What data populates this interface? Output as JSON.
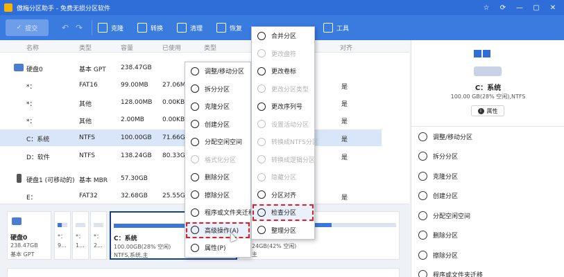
{
  "app": {
    "title": "傲梅分区助手 - 免费无损分区软件",
    "window_buttons": [
      "☆",
      "⟳",
      "—",
      "▢",
      "✕"
    ]
  },
  "toolbar": {
    "commit_label": "提交",
    "undo": "↶",
    "redo": "↷",
    "items": [
      {
        "label": "克隆",
        "icon": "clone-icon"
      },
      {
        "label": "转换",
        "icon": "convert-icon"
      },
      {
        "label": "清理",
        "icon": "clean-icon"
      },
      {
        "label": "恢复",
        "icon": "restore-icon"
      },
      {
        "label": "工具",
        "icon": "tools-icon"
      }
    ]
  },
  "table": {
    "headers": [
      "名称",
      "类型",
      "容量",
      "已使用",
      "类型",
      "对齐"
    ],
    "rows": [
      {
        "name": "硬盘0",
        "type": "基本 GPT",
        "capacity": "238.47GB",
        "used": "",
        "fs": "",
        "align": ""
      },
      {
        "name": "*：",
        "type": "FAT16",
        "capacity": "99.00MB",
        "used": "27.06MB",
        "fs": "",
        "align": "是"
      },
      {
        "name": "*：",
        "type": "其他",
        "capacity": "128.00MB",
        "used": "0.00KB",
        "fs": "",
        "align": "是"
      },
      {
        "name": "*：",
        "type": "其他",
        "capacity": "2.00MB",
        "used": "0.00KB",
        "fs": "",
        "align": "是"
      },
      {
        "name": "C：系统",
        "type": "NTFS",
        "capacity": "100.00GB",
        "used": "71.66GB",
        "fs": "",
        "align": "是"
      },
      {
        "name": "D：软件",
        "type": "NTFS",
        "capacity": "138.24GB",
        "used": "80.33GB",
        "fs": "",
        "align": "是"
      },
      {
        "name": "硬盘1 (可移动的)",
        "type": "基本 MBR",
        "capacity": "57.30GB",
        "used": "",
        "fs": "",
        "align": ""
      },
      {
        "name": "E：",
        "type": "FAT32",
        "capacity": "32.68GB",
        "used": "25.55GB",
        "fs": "",
        "align": "是"
      }
    ]
  },
  "diskmap": {
    "disk_name": "硬盘0",
    "disk_size": "238.47GB",
    "disk_type": "基本 GPT",
    "small": [
      {
        "l1": "*：",
        "l2": "9..."
      },
      {
        "l1": "*：",
        "l2": "1..."
      },
      {
        "l1": "*：",
        "l2": "2..."
      }
    ],
    "c": {
      "l1": "C：系统",
      "l2": "100.00GB(28% 空闲)",
      "l3": "NTFS,系统,主",
      "used": 0.72
    },
    "d": {
      "l2": "24GB(42% 空闲)",
      "l3": "主",
      "used": 0.58
    }
  },
  "rpanel": {
    "title": "C：系统",
    "subtitle": "100.00 GB(28% 空闲),NTFS",
    "props_label": "属性",
    "items": [
      {
        "label": "调整/移动分区",
        "icon": "resize-icon"
      },
      {
        "label": "拆分分区",
        "icon": "split-icon"
      },
      {
        "label": "克隆分区",
        "icon": "clone-partition-icon"
      },
      {
        "label": "创建分区",
        "icon": "create-icon"
      },
      {
        "label": "分配空闲空间",
        "icon": "allocate-icon"
      },
      {
        "label": "删除分区",
        "icon": "delete-icon"
      },
      {
        "label": "擦除分区",
        "icon": "wipe-icon"
      },
      {
        "label": "程序或文件夹迁移",
        "icon": "migrate-icon"
      }
    ]
  },
  "menu1": [
    {
      "label": "调整/移动分区",
      "icon": "resize-icon",
      "state": "normal"
    },
    {
      "label": "拆分分区",
      "icon": "split-icon",
      "state": "normal"
    },
    {
      "label": "克隆分区",
      "icon": "clone-partition-icon",
      "state": "normal"
    },
    {
      "label": "创建分区",
      "icon": "create-icon",
      "state": "normal"
    },
    {
      "label": "分配空闲空间",
      "icon": "allocate-icon",
      "state": "normal"
    },
    {
      "label": "格式化分区",
      "icon": "format-icon",
      "state": "disabled"
    },
    {
      "label": "删除分区",
      "icon": "delete-icon",
      "state": "normal"
    },
    {
      "label": "擦除分区",
      "icon": "wipe-icon",
      "state": "normal"
    },
    {
      "label": "程序或文件夹迁移",
      "icon": "migrate-icon",
      "state": "normal"
    },
    {
      "label": "高级操作(A)",
      "icon": "more-icon",
      "state": "highlight"
    },
    {
      "label": "属性(P)",
      "icon": "info-icon",
      "state": "normal"
    }
  ],
  "menu2": [
    {
      "label": "合并分区",
      "icon": "merge-icon",
      "state": "normal"
    },
    {
      "label": "更改盘符",
      "icon": "drive-letter-icon",
      "state": "disabled"
    },
    {
      "label": "更改卷标",
      "icon": "label-icon",
      "state": "normal"
    },
    {
      "label": "更改分区类型",
      "icon": "id-icon",
      "state": "disabled"
    },
    {
      "label": "更改序列号",
      "icon": "serial-icon",
      "state": "normal"
    },
    {
      "label": "设置活动分区",
      "icon": "active-icon",
      "state": "disabled"
    },
    {
      "label": "转换成NTFS分区",
      "icon": "convert-ntfs-icon",
      "state": "disabled"
    },
    {
      "label": "转换成逻辑分区",
      "icon": "convert-logical-icon",
      "state": "disabled"
    },
    {
      "label": "隐藏分区",
      "icon": "hide-icon",
      "state": "disabled"
    },
    {
      "label": "分区对齐",
      "icon": "align-icon",
      "state": "normal"
    },
    {
      "label": "检查分区",
      "icon": "check-icon",
      "state": "highlight"
    },
    {
      "label": "整理分区",
      "icon": "defrag-icon",
      "state": "normal"
    }
  ]
}
